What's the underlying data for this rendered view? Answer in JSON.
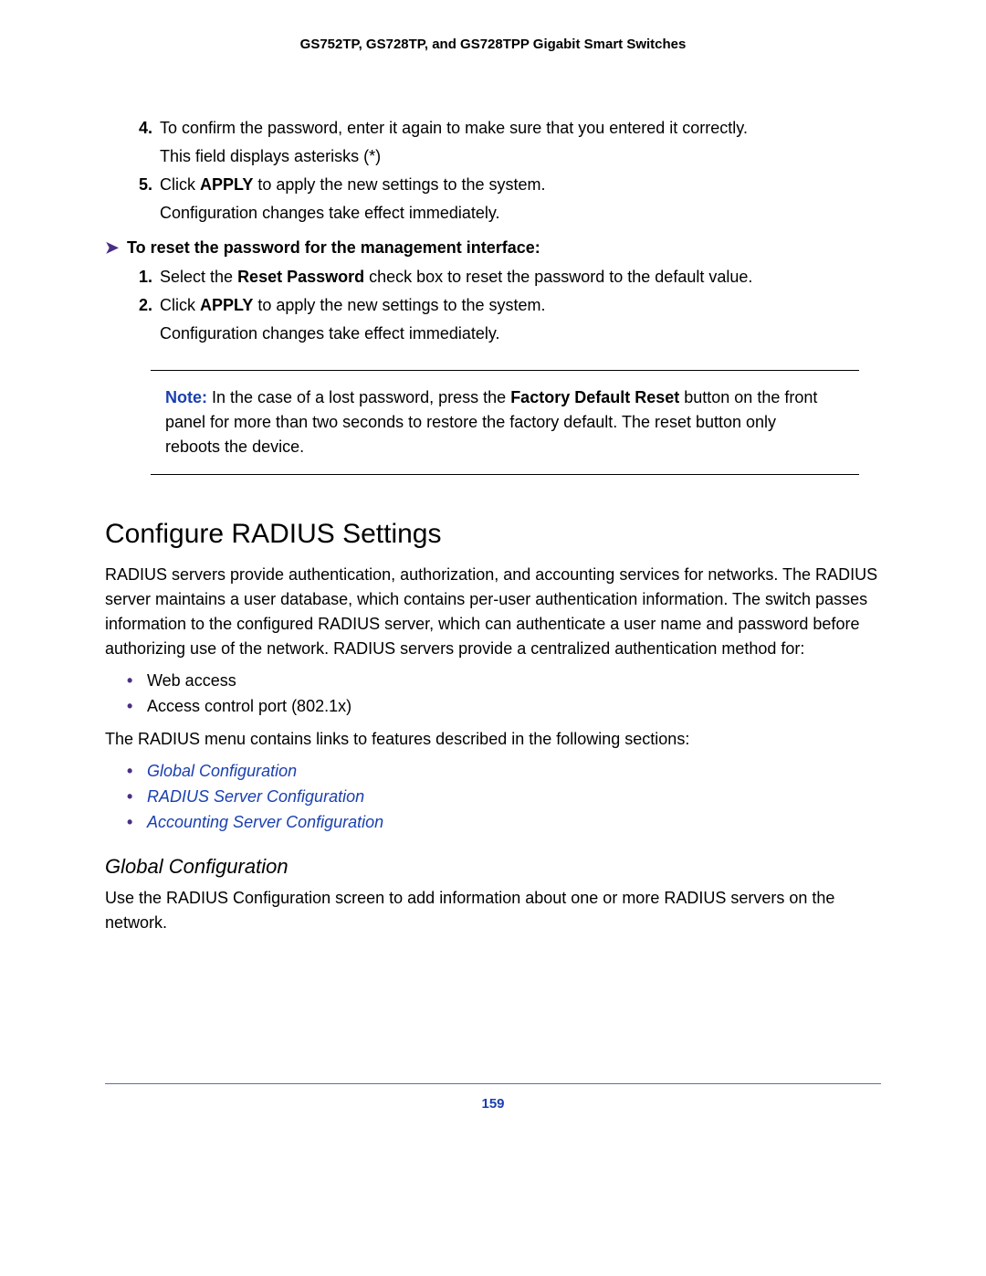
{
  "header": "GS752TP, GS728TP, and GS728TPP Gigabit Smart Switches",
  "steps_a": [
    {
      "num": "4.",
      "line1_a": "To confirm the password, enter it again to make sure that you entered it correctly.",
      "line2": "This field displays asterisks (*)"
    },
    {
      "num": "5.",
      "line1_a": "Click ",
      "line1_bold": "APPLY",
      "line1_b": " to apply the new settings to the system.",
      "line2": "Configuration changes take effect immediately."
    }
  ],
  "task_heading": "To reset the password for the management interface:",
  "steps_b": [
    {
      "num": "1.",
      "line1_a": "Select the ",
      "line1_bold": "Reset Password",
      "line1_b": " check box to reset the password to the default value."
    },
    {
      "num": "2.",
      "line1_a": "Click ",
      "line1_bold": "APPLY",
      "line1_b": " to apply the new settings to the system.",
      "line2": "Configuration changes take effect immediately."
    }
  ],
  "note": {
    "label": "Note:",
    "pre": " In the case of a lost password, press the ",
    "bold": "Factory Default Reset",
    "post": " button on the front panel for more than two seconds to restore the factory default. The reset button only reboots the device."
  },
  "h2": "Configure RADIUS Settings",
  "radius_para": "RADIUS servers provide authentication, authorization, and accounting services for networks. The RADIUS server maintains a user database, which contains per-user authentication information. The switch passes information to the configured RADIUS server, which can authenticate a user name and password before authorizing use of the network. RADIUS servers provide a centralized authentication method for:",
  "bullets_plain": [
    "Web access",
    "Access control port (802.1x)"
  ],
  "menu_para": "The RADIUS menu contains links to features described in the following sections:",
  "links": [
    "Global Configuration",
    "RADIUS Server Configuration",
    "Accounting Server Configuration"
  ],
  "h3": "Global Configuration",
  "gc_para": "Use the RADIUS Configuration screen to add information about one or more RADIUS servers on the network.",
  "page_number": "159"
}
